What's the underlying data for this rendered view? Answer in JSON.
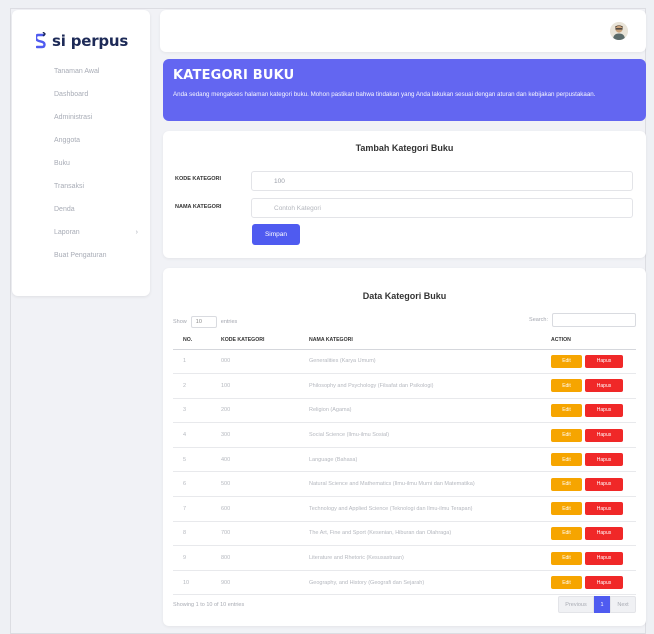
{
  "app": {
    "brand": "si perpus"
  },
  "sidebar": {
    "items": [
      {
        "label": "Tanaman Awal"
      },
      {
        "label": "Dashboard"
      },
      {
        "label": "Administrasi"
      },
      {
        "label": "Anggota"
      },
      {
        "label": "Buku"
      },
      {
        "label": "Transaksi"
      },
      {
        "label": "Denda"
      },
      {
        "label": "Laporan",
        "chevron": "›"
      },
      {
        "label": "Buat Pengaturan"
      }
    ]
  },
  "banner": {
    "title": "KATEGORI BUKU",
    "description": "Anda sedang mengakses halaman kategori buku. Mohon pastikan bahwa tindakan yang Anda lakukan sesuai dengan aturan dan kebijakan perpustakaan."
  },
  "form": {
    "title": "Tambah Kategori Buku",
    "kode_label": "KODE KATEGORI",
    "kode_value": "100",
    "nama_label": "NAMA KATEGORI",
    "nama_placeholder": "Contoh Kategori",
    "submit_label": "Simpan"
  },
  "table": {
    "title": "Data Kategori Buku",
    "show_label": "Show",
    "show_value": "10",
    "entries_label": "entries",
    "search_label": "Search:",
    "headers": [
      "NO.",
      "KODE KATEGORI",
      "NAMA KATEGORI",
      "ACTION"
    ],
    "edit_label": "Edit",
    "delete_label": "Hapus",
    "rows": [
      {
        "no": "1",
        "kode": "000",
        "nama": "Generalities (Karya Umum)"
      },
      {
        "no": "2",
        "kode": "100",
        "nama": "Philosophy and Psychology (Filsafat dan Psikologi)"
      },
      {
        "no": "3",
        "kode": "200",
        "nama": "Religion (Agama)"
      },
      {
        "no": "4",
        "kode": "300",
        "nama": "Social Science (Ilmu-ilmu Sosial)"
      },
      {
        "no": "5",
        "kode": "400",
        "nama": "Language (Bahasa)"
      },
      {
        "no": "6",
        "kode": "500",
        "nama": "Natural Science and Mathematics (Ilmu-ilmu Murni dan Matematika)"
      },
      {
        "no": "7",
        "kode": "600",
        "nama": "Technology and Applied Science (Teknologi dan Ilmu-ilmu Terapan)"
      },
      {
        "no": "8",
        "kode": "700",
        "nama": "The Art, Fine and Sport (Kesenian, Hiburan dan Olahraga)"
      },
      {
        "no": "9",
        "kode": "800",
        "nama": "Literature and Rhetoric (Kesusastraan)"
      },
      {
        "no": "10",
        "kode": "900",
        "nama": "Geography, and History (Geografi dan Sejarah)"
      }
    ],
    "info": "Showing 1 to 10 of 10 entries",
    "pager": {
      "prev": "Previous",
      "page": "1",
      "next": "Next"
    }
  },
  "colors": {
    "accent": "#6366f1",
    "button_primary": "#4f5bf0",
    "edit": "#f6a500",
    "delete": "#f02828",
    "brand_text": "#1d2a57"
  }
}
